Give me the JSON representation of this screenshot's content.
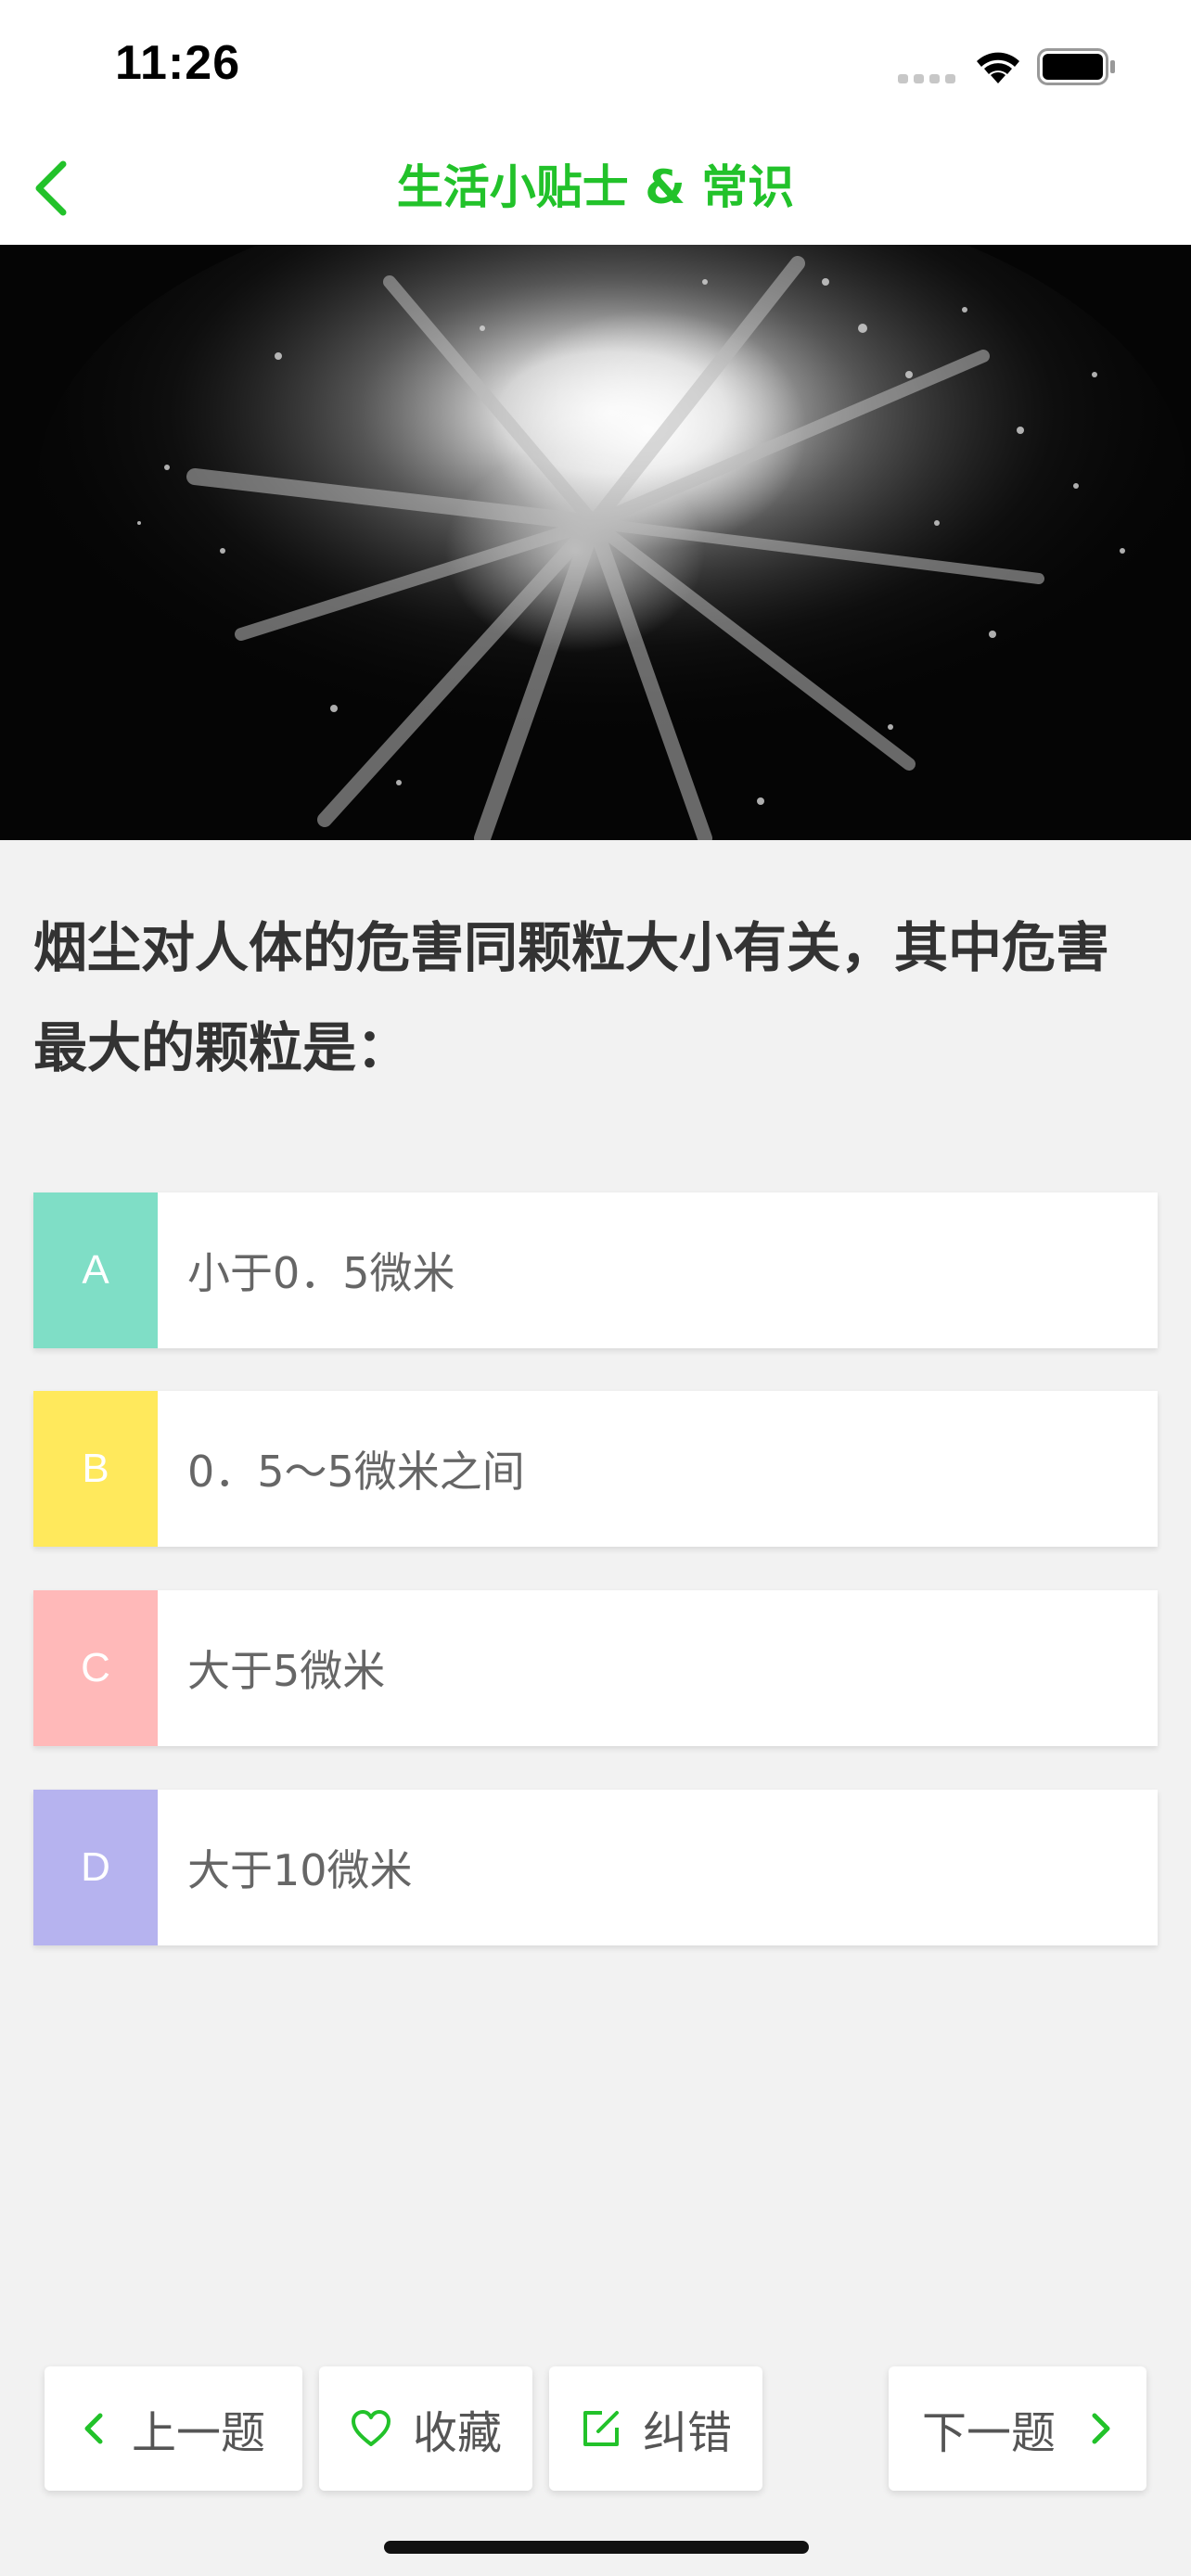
{
  "status_bar": {
    "time": "11:26",
    "icons": [
      "signal-icon",
      "wifi-icon",
      "battery-icon"
    ]
  },
  "nav": {
    "back_icon": "chevron-left-icon",
    "title": "生活小贴士 & 常识"
  },
  "hero": {
    "image": "powder-explosion-photo"
  },
  "question": {
    "text": "烟尘对人体的危害同颗粒大小有关，其中危害最大的颗粒是："
  },
  "options": [
    {
      "letter": "A",
      "text": "小于0．5微米",
      "color": "#7fdec6"
    },
    {
      "letter": "B",
      "text": "0．5～5微米之间",
      "color": "#ffe95c"
    },
    {
      "letter": "C",
      "text": "大于5微米",
      "color": "#ffb9b9"
    },
    {
      "letter": "D",
      "text": "大于10微米",
      "color": "#b6b3ef"
    }
  ],
  "toolbar": {
    "prev_label": "上一题",
    "favorite_label": "收藏",
    "report_label": "纠错",
    "next_label": "下一题",
    "accent": "#22c22a"
  }
}
